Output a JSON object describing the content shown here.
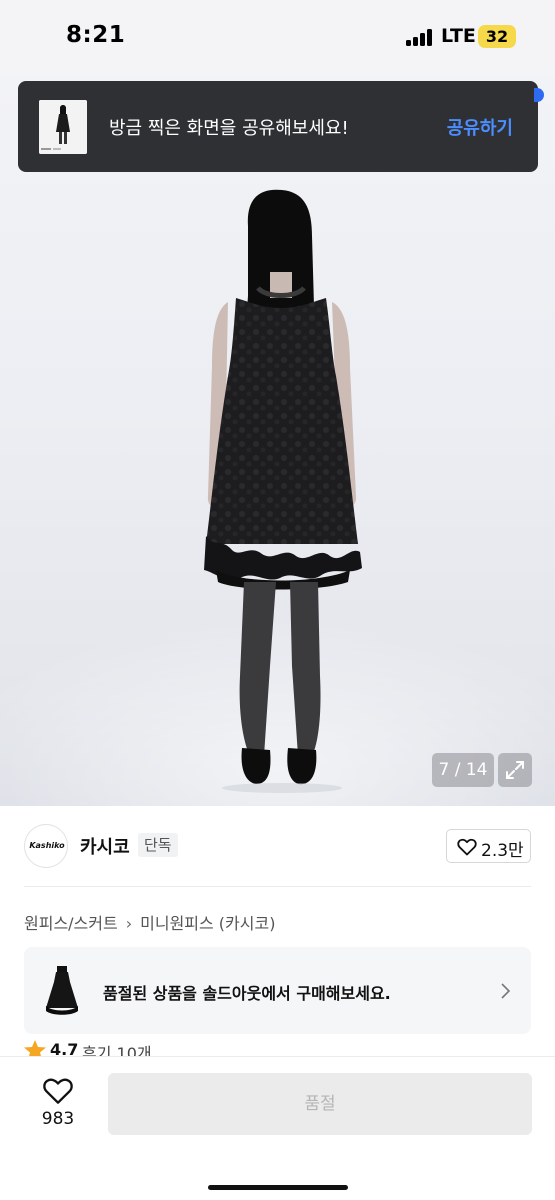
{
  "status_bar": {
    "time": "8:21",
    "network": "LTE",
    "battery": "32"
  },
  "share_banner": {
    "message": "방금 찍은 화면을 공유해보세요!",
    "action_label": "공유하기"
  },
  "gallery": {
    "counter": "7 / 14"
  },
  "brand": {
    "logo_text": "Kashiko",
    "name": "카시코",
    "tag": "단독"
  },
  "likes": {
    "top_count": "2.3만",
    "bottom_count": "983"
  },
  "breadcrumb": [
    "원피스/스커트",
    "미니원피스 (카시코)"
  ],
  "soldout_card": {
    "message": "품절된 상품을 솔드아웃에서 구매해보세요."
  },
  "rating": {
    "value": "4.7",
    "reviews": "후기 10개"
  },
  "buy_button": {
    "label": "품절"
  },
  "colors": {
    "banner_bg": "#2e3033",
    "link_blue": "#4c8dff",
    "star": "#f5a623",
    "battery": "#f5d94a"
  }
}
